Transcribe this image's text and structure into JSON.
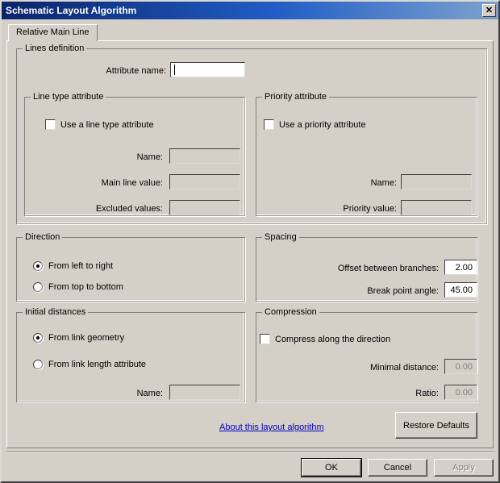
{
  "window": {
    "title": "Schematic Layout Algorithm",
    "close_icon": "close-icon",
    "close_glyph": "✕",
    "accent_title_start": "#0a246a",
    "accent_title_end": "#7da2ce",
    "dialog_bg": "#d4d0c8",
    "link_color": "#0000cc"
  },
  "tabs": [
    {
      "label": "Relative Main Line",
      "selected": true
    }
  ],
  "lines_definition": {
    "title": "Lines definition",
    "attribute_name": {
      "label": "Attribute name:",
      "value": "",
      "placeholder": "",
      "enabled": true,
      "focused": true
    },
    "line_type_attribute": {
      "title": "Line type attribute",
      "use_checkbox": {
        "label": "Use a line type attribute",
        "checked": false
      },
      "fields": [
        {
          "label": "Name:",
          "value": "",
          "enabled": false
        },
        {
          "label": "Main line value:",
          "value": "",
          "enabled": false
        },
        {
          "label": "Excluded values:",
          "value": "",
          "enabled": false
        }
      ]
    },
    "priority_attribute": {
      "title": "Priority attribute",
      "use_checkbox": {
        "label": "Use a priority attribute",
        "checked": false
      },
      "fields": [
        {
          "label": "Name:",
          "value": "",
          "enabled": false
        },
        {
          "label": "Priority value:",
          "value": "",
          "enabled": false
        }
      ]
    }
  },
  "direction": {
    "title": "Direction",
    "options": [
      {
        "label": "From left to right",
        "selected": true
      },
      {
        "label": "From top to bottom",
        "selected": false
      }
    ]
  },
  "spacing": {
    "title": "Spacing",
    "fields": [
      {
        "label": "Offset between branches:",
        "value": "2.00",
        "enabled": true
      },
      {
        "label": "Break point angle:",
        "value": "45.00",
        "enabled": true
      }
    ]
  },
  "initial_distances": {
    "title": "Initial distances",
    "options": [
      {
        "label": "From link geometry",
        "selected": true
      },
      {
        "label": "From link length attribute",
        "selected": false
      }
    ],
    "name_field": {
      "label": "Name:",
      "value": "",
      "enabled": false
    }
  },
  "compression": {
    "title": "Compression",
    "use_checkbox": {
      "label": "Compress along the direction",
      "checked": false
    },
    "fields": [
      {
        "label": "Minimal distance:",
        "value": "0.00",
        "enabled": false
      },
      {
        "label": "Ratio:",
        "value": "0.00",
        "enabled": false
      }
    ]
  },
  "footer": {
    "about_link": "About this layout algorithm",
    "restore_defaults": "Restore Defaults",
    "ok": "OK",
    "cancel": "Cancel",
    "apply": "Apply",
    "apply_enabled": false
  }
}
